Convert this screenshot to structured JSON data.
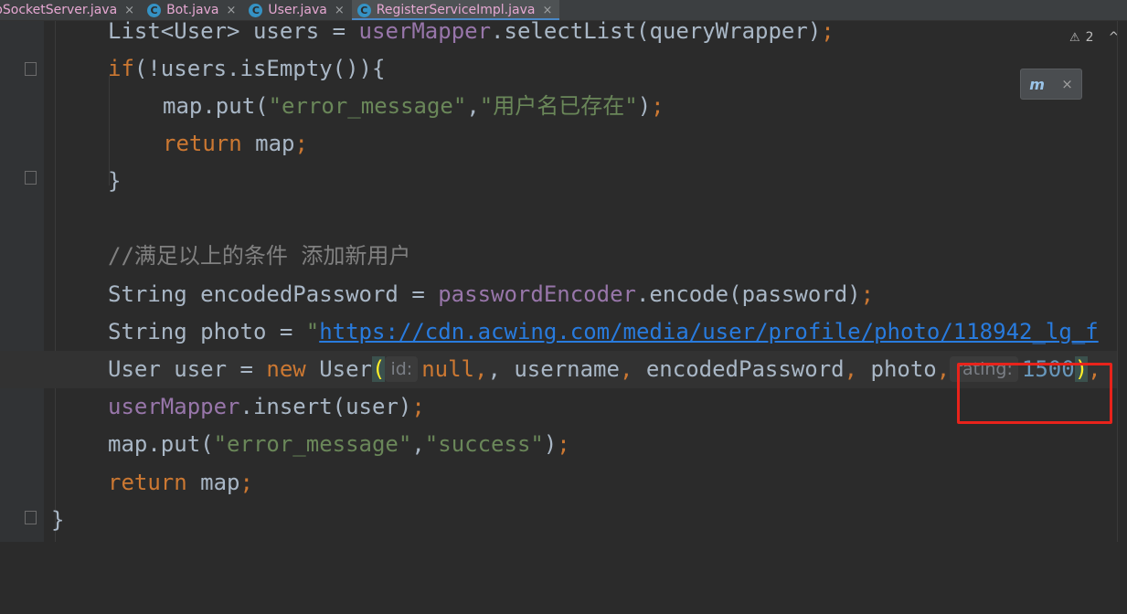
{
  "tabs": [
    {
      "label": "bSocketServer.java",
      "icon": "",
      "active": false
    },
    {
      "label": "Bot.java",
      "icon": "C",
      "active": false
    },
    {
      "label": "User.java",
      "icon": "C",
      "active": false
    },
    {
      "label": "RegisterServiceImpl.java",
      "icon": "C",
      "active": true
    }
  ],
  "tab_close_glyph": "×",
  "inspections": {
    "warnings": "2",
    "warning_glyph": "⚠",
    "chevron": "^"
  },
  "maven_widget": {
    "icon_text": "m",
    "close": "×"
  },
  "code": {
    "l1": {
      "a": "List<User> users = ",
      "b": "userMapper",
      "c": ".selectList(queryWrapper)",
      "d": ";"
    },
    "l2": {
      "a": "if",
      "b": "(!users.isEmpty()){"
    },
    "l3": {
      "a": "map.put(",
      "b": "\"error_message\"",
      "c": ",",
      "d": "\"用户名已存在\"",
      "e": ")",
      "f": ";"
    },
    "l4": {
      "a": "return",
      "b": " map",
      "c": ";"
    },
    "l5": {
      "a": "}"
    },
    "l7": {
      "a": "//满足以上的条件 添加新用户"
    },
    "l8": {
      "a": "String encodedPassword = ",
      "b": "passwordEncoder",
      "c": ".encode(password)",
      "d": ";"
    },
    "l9": {
      "a": "String photo = ",
      "b": "\"",
      "c": "https://cdn.acwing.com/media/user/profile/photo/118942_lg_f"
    },
    "l10": {
      "a": "User user = ",
      "b": "new",
      "c": " User",
      "d": "(",
      "hint1": "id:",
      "e": "null",
      "f": ", username",
      "g": ",",
      "h": " encodedPassword",
      "i": ",",
      "j": " photo",
      "k": ",",
      "hint2": "rating:",
      "l": "1500",
      "m": ")",
      "n": ","
    },
    "l11": {
      "a": "userMapper",
      "b": ".insert(user)",
      "c": ";"
    },
    "l12": {
      "a": "map.put(",
      "b": "\"error_message\"",
      "c": ",",
      "d": "\"success\"",
      "e": ")",
      "f": ";"
    },
    "l13": {
      "a": "return",
      "b": " map",
      "c": ";"
    },
    "l14": {
      "a": "}"
    }
  }
}
